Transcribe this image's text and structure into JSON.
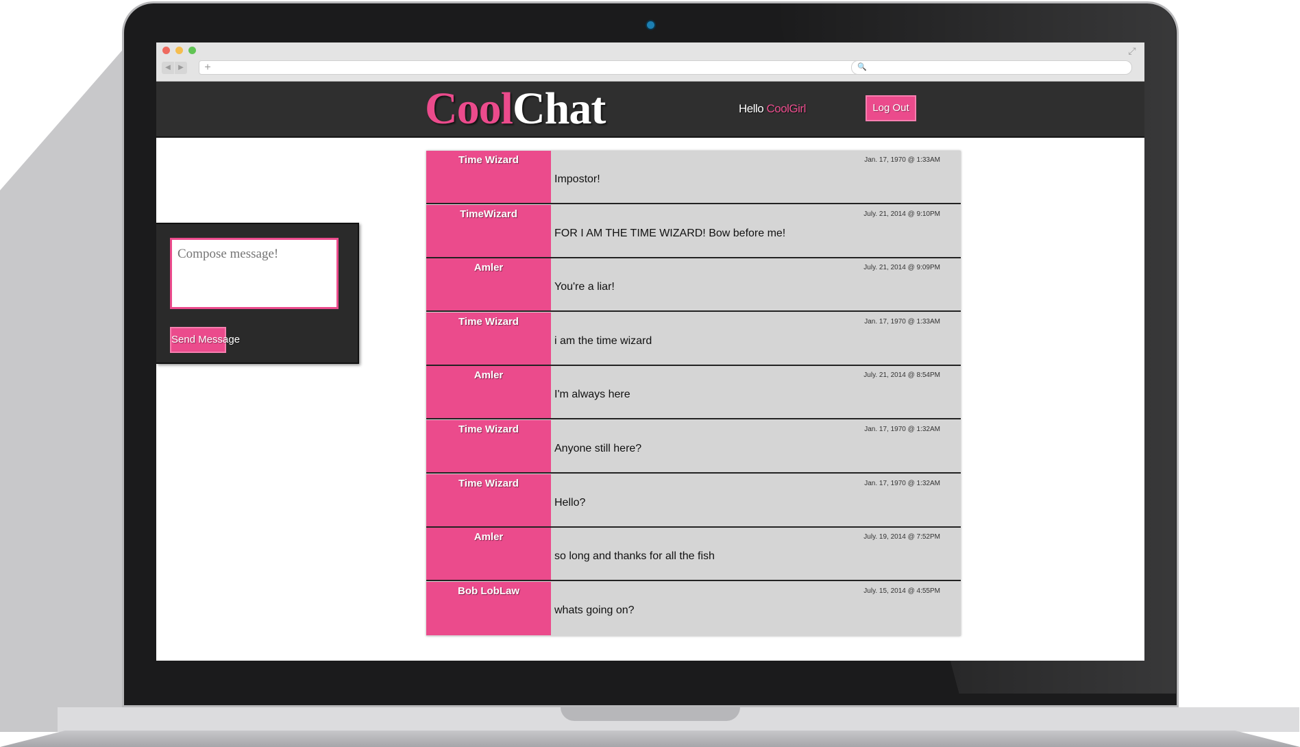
{
  "browser": {
    "nav_back_glyph": "◀",
    "nav_forward_glyph": "▶",
    "new_tab_glyph": "+",
    "search_glyph": "🔍",
    "expand_glyph": "⤢",
    "url": "",
    "search": ""
  },
  "header": {
    "logo_part1": "Cool",
    "logo_part2": "Chat",
    "greeting": "Hello ",
    "username": "CoolGirl",
    "logout_label": "Log Out"
  },
  "compose": {
    "placeholder": "Compose message!",
    "send_label": "Send Message"
  },
  "messages": [
    {
      "author": "Time Wizard",
      "time": "Jan. 17, 1970 @ 1:33AM",
      "text": "Impostor!"
    },
    {
      "author": "TimeWizard",
      "time": "July. 21, 2014 @ 9:10PM",
      "text": "FOR I AM THE TIME WIZARD! Bow before me!"
    },
    {
      "author": "Amler",
      "time": "July. 21, 2014 @ 9:09PM",
      "text": "You're a liar!"
    },
    {
      "author": "Time Wizard",
      "time": "Jan. 17, 1970 @ 1:33AM",
      "text": "i am the time wizard"
    },
    {
      "author": "Amler",
      "time": "July. 21, 2014 @ 8:54PM",
      "text": "I'm always here"
    },
    {
      "author": "Time Wizard",
      "time": "Jan. 17, 1970 @ 1:32AM",
      "text": "Anyone still here?"
    },
    {
      "author": "Time Wizard",
      "time": "Jan. 17, 1970 @ 1:32AM",
      "text": "Hello?"
    },
    {
      "author": "Amler",
      "time": "July. 19, 2014 @ 7:52PM",
      "text": "so long and thanks for all the fish"
    },
    {
      "author": "Bob LobLaw",
      "time": "July. 15, 2014 @ 4:55PM",
      "text": "whats going on?"
    }
  ],
  "colors": {
    "accent": "#eb4b8c",
    "header_bg": "#2f2f2f",
    "message_bg": "#d5d5d5"
  }
}
